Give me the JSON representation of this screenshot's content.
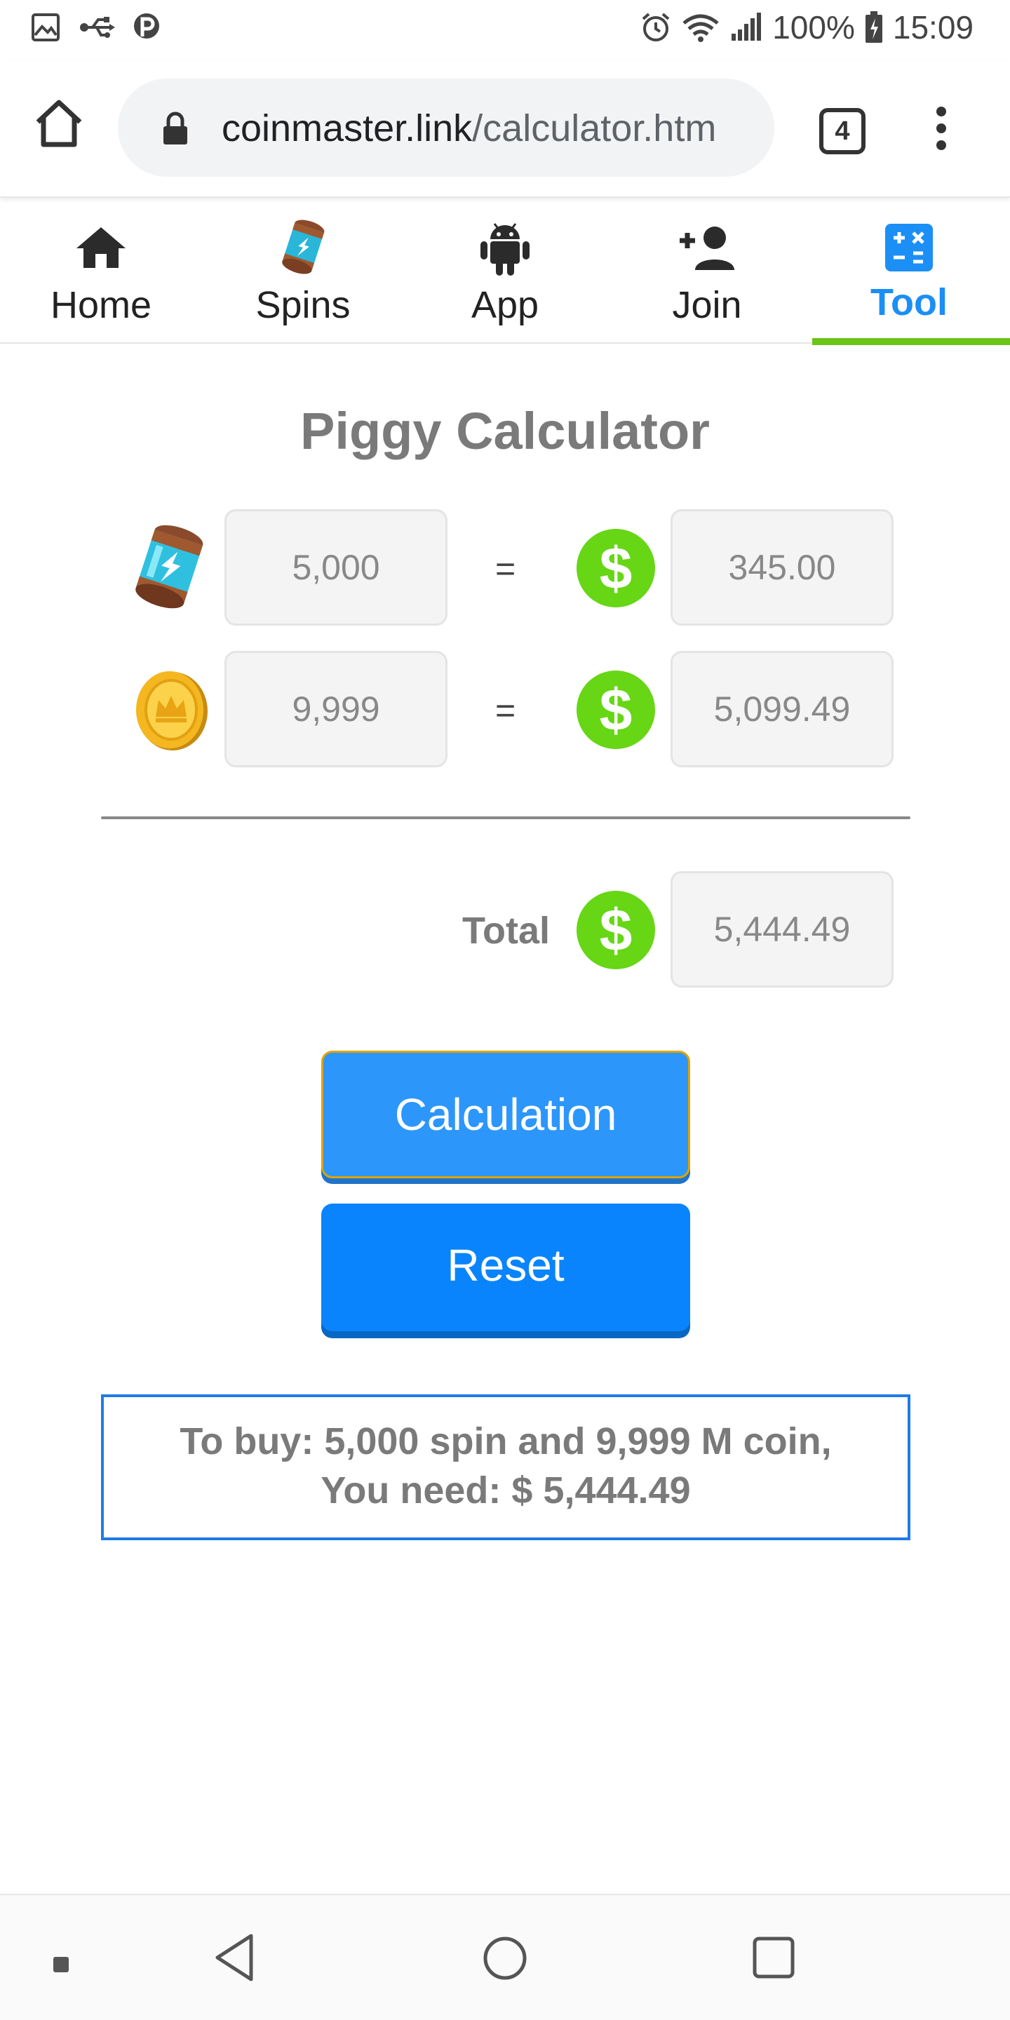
{
  "status_bar": {
    "battery_percent": "100%",
    "time": "15:09"
  },
  "browser": {
    "url_host": "coinmaster.link",
    "url_path": "/calculator.htm",
    "tab_count": "4"
  },
  "site_nav": {
    "items": [
      {
        "label": "Home",
        "icon": "home-icon"
      },
      {
        "label": "Spins",
        "icon": "spin-energy-icon"
      },
      {
        "label": "App",
        "icon": "android-icon"
      },
      {
        "label": "Join",
        "icon": "add-user-icon"
      },
      {
        "label": "Tool",
        "icon": "calculator-icon",
        "active": true
      }
    ],
    "active_color": "#1b8ff5",
    "active_underline_color": "#6cc417"
  },
  "calculator": {
    "title": "Piggy Calculator",
    "equals": "=",
    "currency_symbol": "$",
    "spins": {
      "icon": "spin-energy-icon",
      "amount": "5,000",
      "price": "345.00"
    },
    "coins": {
      "icon": "coin-icon",
      "amount": "9,999",
      "price": "5,099.49"
    },
    "total_label": "Total",
    "total_value": "5,444.49",
    "calc_button": "Calculation",
    "reset_button": "Reset",
    "result_line1": "To buy: 5,000 spin and 9,999 M coin,",
    "result_line2": "You need: $ 5,444.49",
    "dollar_color": "#66d615",
    "button_color": "#2d96fb"
  }
}
